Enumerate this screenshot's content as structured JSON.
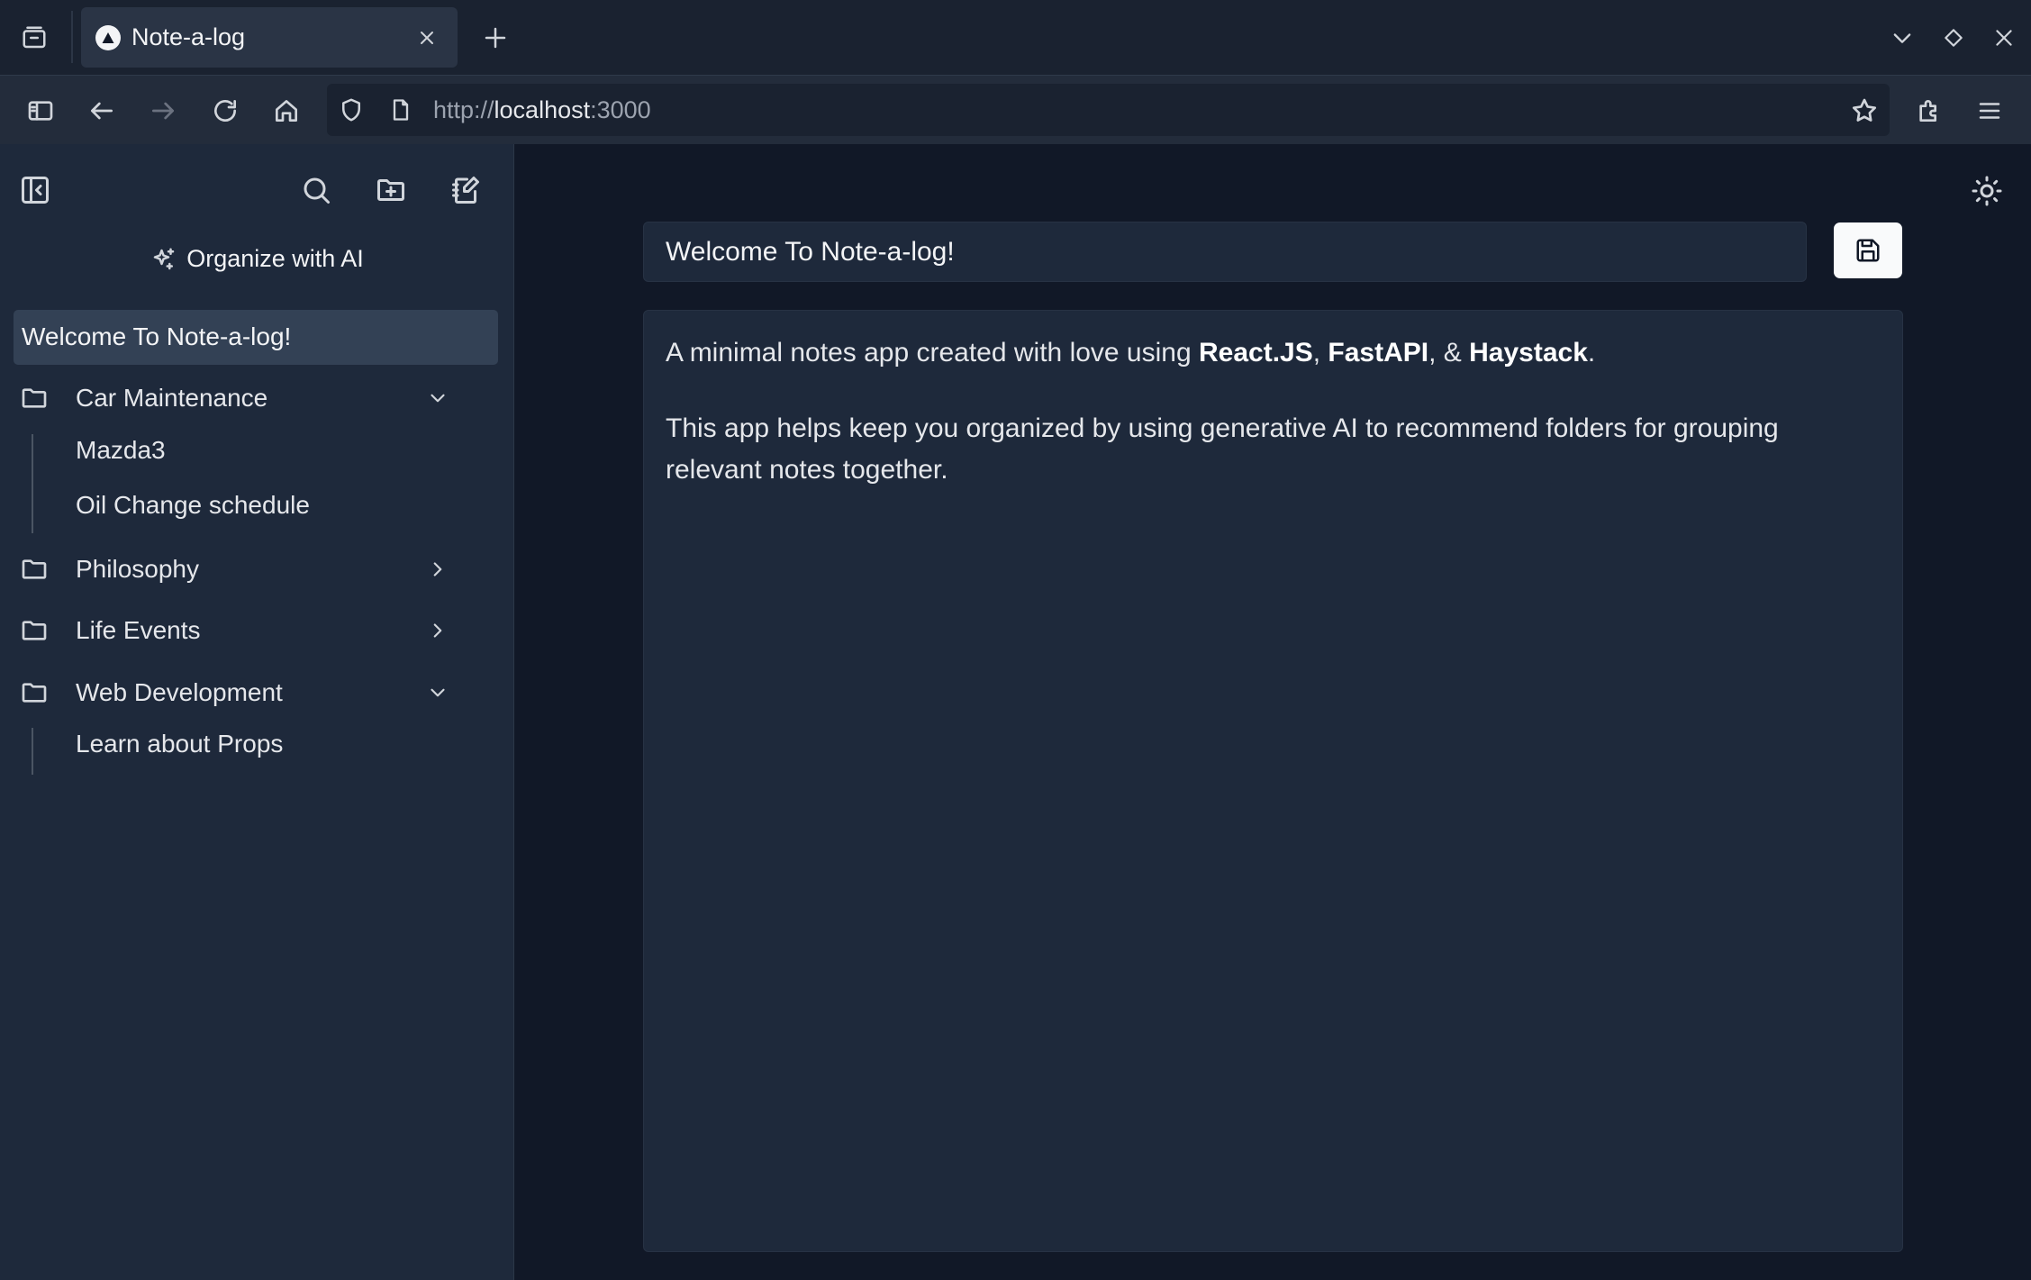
{
  "browser": {
    "tab_title": "Note-a-log",
    "url_scheme": "http://",
    "url_host": "localhost",
    "url_port": ":3000"
  },
  "sidebar": {
    "organize_label": "Organize with AI",
    "active_note": "Welcome To Note-a-log!",
    "folders": [
      {
        "name": "Car Maintenance",
        "expanded": true,
        "notes": [
          "Mazda3",
          "Oil Change schedule"
        ]
      },
      {
        "name": "Philosophy",
        "expanded": false,
        "notes": []
      },
      {
        "name": "Life Events",
        "expanded": false,
        "notes": []
      },
      {
        "name": "Web Development",
        "expanded": true,
        "notes": [
          "Learn about Props"
        ]
      }
    ]
  },
  "editor": {
    "title_value": "Welcome To Note-a-log!",
    "p1_intro": "A minimal notes app created with love using ",
    "p1_tech1": "React.JS",
    "p1_sep1": ", ",
    "p1_tech2": "FastAPI",
    "p1_sep2": ", & ",
    "p1_tech3": "Haystack",
    "p1_end": ".",
    "p2": "This app helps keep you organized by using generative AI to recommend folders for grouping relevant notes together."
  },
  "icons": {
    "tab_list": "tab-list-icon",
    "new_tab": "plus-icon",
    "sidebar_toggle": "sidebar-icon",
    "back": "arrow-left-icon",
    "forward": "arrow-right-icon",
    "reload": "reload-icon",
    "home": "home-icon",
    "bookmark": "star-icon",
    "extensions": "puzzle-icon",
    "menu": "hamburger-icon",
    "theme": "sun-icon",
    "save": "floppy-icon"
  }
}
